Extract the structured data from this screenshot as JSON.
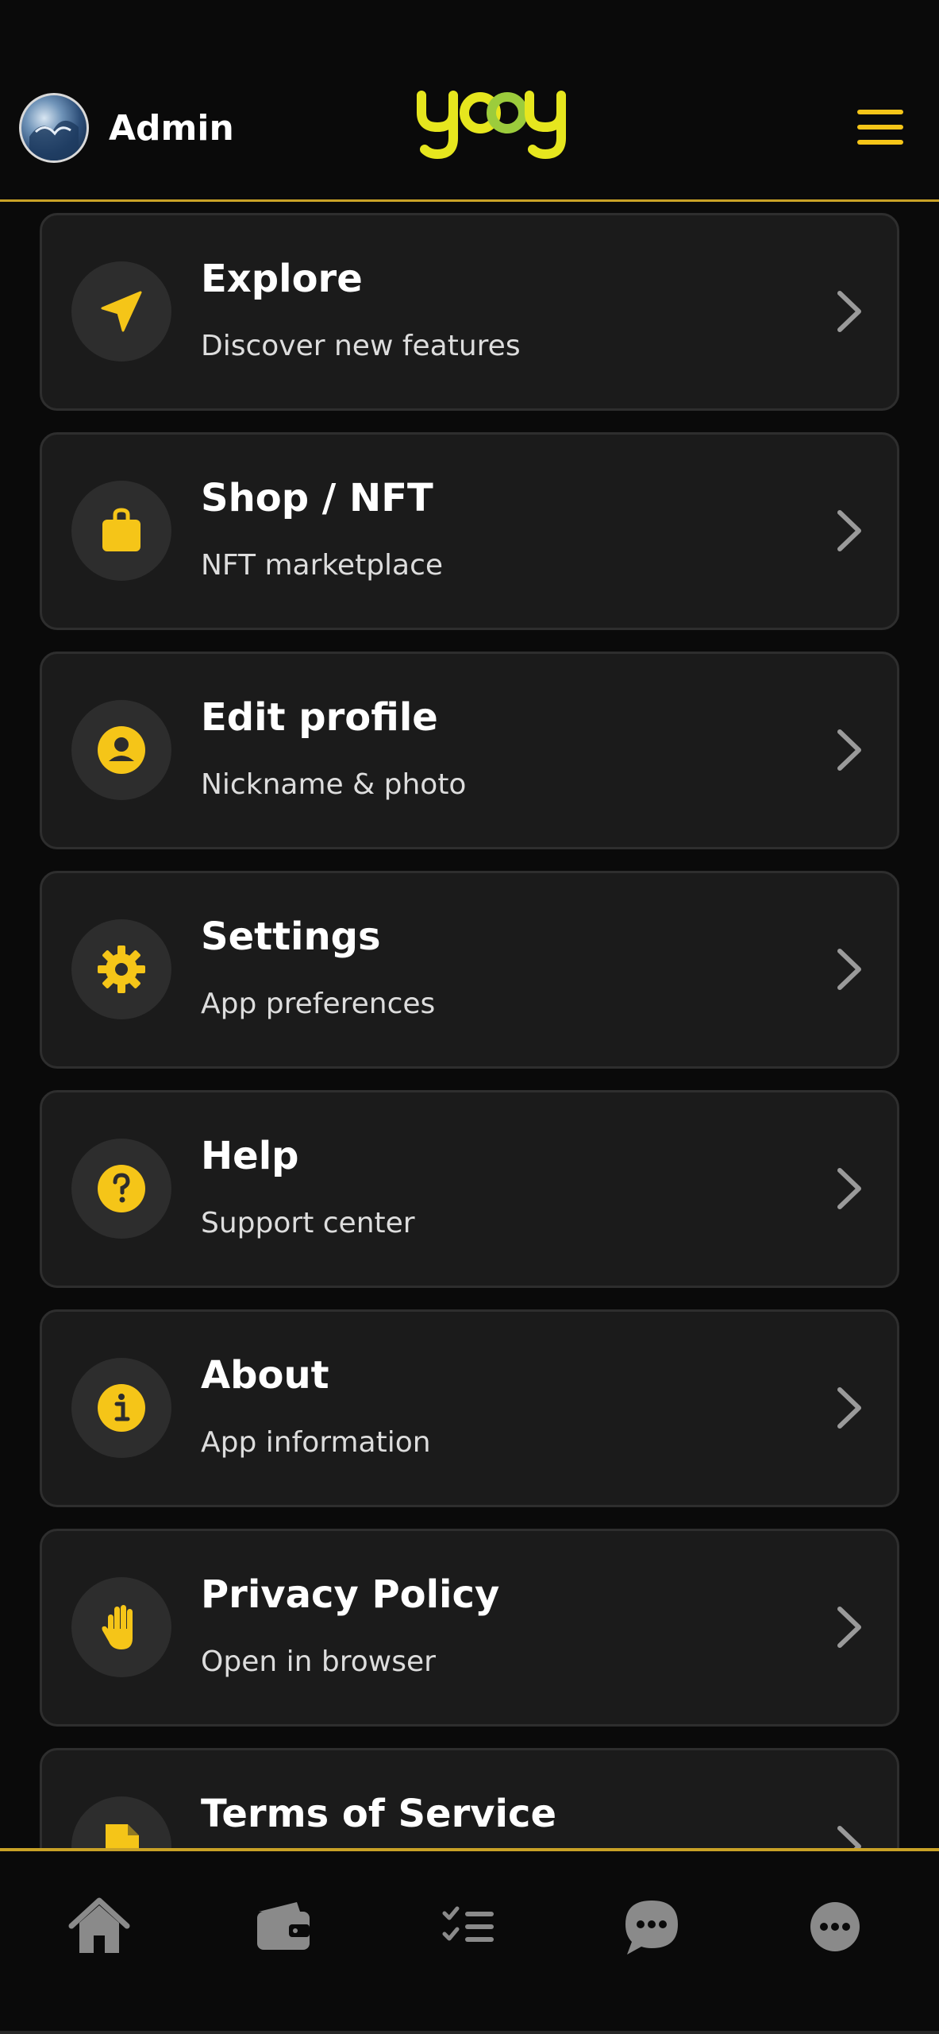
{
  "header": {
    "user_name": "Admin",
    "logo_text": "yooy",
    "menu_icon": "hamburger-menu-icon",
    "accent_color": "#f5c518",
    "divider_color": "#c9a227"
  },
  "menu": {
    "items": [
      {
        "title": "Explore",
        "subtitle": "Discover new features",
        "icon": "paper-plane-icon"
      },
      {
        "title": "Shop / NFT",
        "subtitle": "NFT marketplace",
        "icon": "shopping-bag-icon"
      },
      {
        "title": "Edit profile",
        "subtitle": "Nickname & photo",
        "icon": "user-circle-icon"
      },
      {
        "title": "Settings",
        "subtitle": "App preferences",
        "icon": "gear-icon"
      },
      {
        "title": "Help",
        "subtitle": "Support center",
        "icon": "question-circle-icon"
      },
      {
        "title": "About",
        "subtitle": "App information",
        "icon": "info-circle-icon"
      },
      {
        "title": "Privacy Policy",
        "subtitle": "Open in browser",
        "icon": "hand-stop-icon"
      },
      {
        "title": "Terms of Service",
        "subtitle": "",
        "icon": "document-icon"
      }
    ]
  },
  "bottom_nav": {
    "items": [
      {
        "icon": "home-icon"
      },
      {
        "icon": "wallet-icon"
      },
      {
        "icon": "checklist-icon"
      },
      {
        "icon": "chat-bubble-icon"
      },
      {
        "icon": "more-icon"
      }
    ]
  }
}
